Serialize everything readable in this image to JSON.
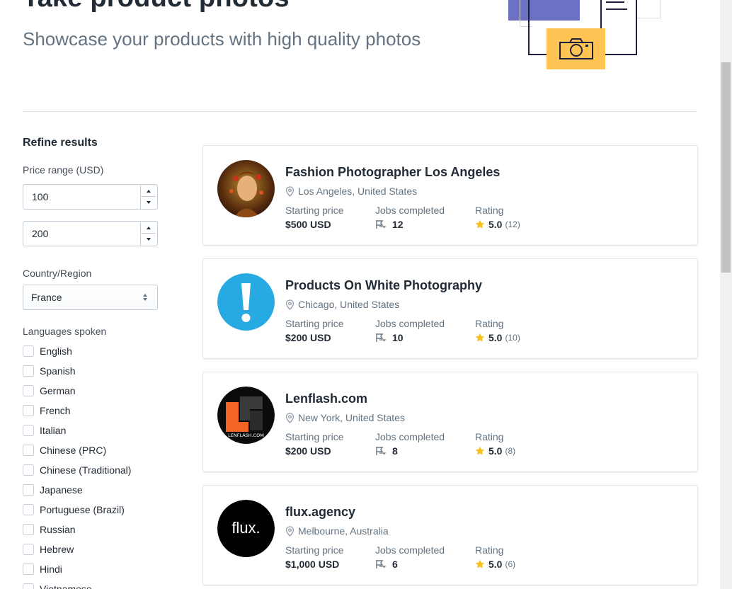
{
  "header": {
    "title": "Take product photos",
    "subtitle": "Showcase your products with high quality photos"
  },
  "colors": {
    "accent_purple": "#6c71c4",
    "accent_yellow": "#ffc453",
    "star": "#f5c21b"
  },
  "sidebar": {
    "title": "Refine results",
    "price_label": "Price range (USD)",
    "price_min": "100",
    "price_max": "200",
    "country_label": "Country/Region",
    "country_value": "France",
    "languages_label": "Languages spoken",
    "languages": [
      {
        "label": "English",
        "checked": false
      },
      {
        "label": "Spanish",
        "checked": false
      },
      {
        "label": "German",
        "checked": false
      },
      {
        "label": "French",
        "checked": false
      },
      {
        "label": "Italian",
        "checked": false
      },
      {
        "label": "Chinese (PRC)",
        "checked": false
      },
      {
        "label": "Chinese (Traditional)",
        "checked": false
      },
      {
        "label": "Japanese",
        "checked": false
      },
      {
        "label": "Portuguese (Brazil)",
        "checked": false
      },
      {
        "label": "Russian",
        "checked": false
      },
      {
        "label": "Hebrew",
        "checked": false
      },
      {
        "label": "Hindi",
        "checked": false
      },
      {
        "label": "Vietnamese",
        "checked": false
      }
    ]
  },
  "results": {
    "price_label": "Starting price",
    "jobs_label": "Jobs completed",
    "rating_label": "Rating",
    "items": [
      {
        "name": "Fashion Photographer Los Angeles",
        "location": "Los Angeles, United States",
        "price": "$500 USD",
        "jobs": "12",
        "rating": "5.0",
        "reviews": "(12)",
        "avatar": "portrait-photo"
      },
      {
        "name": "Products On White Photography",
        "location": "Chicago, United States",
        "price": "$200 USD",
        "jobs": "10",
        "rating": "5.0",
        "reviews": "(10)",
        "avatar": "exclamation-logo"
      },
      {
        "name": "Lenflash.com",
        "location": "New York, United States",
        "price": "$200 USD",
        "jobs": "8",
        "rating": "5.0",
        "reviews": "(8)",
        "avatar": "lenflash-logo",
        "avatar_text": "LENFLASH.COM"
      },
      {
        "name": "flux.agency",
        "location": "Melbourne, Australia",
        "price": "$1,000 USD",
        "jobs": "6",
        "rating": "5.0",
        "reviews": "(6)",
        "avatar": "flux-logo",
        "avatar_text": "flux."
      }
    ]
  }
}
